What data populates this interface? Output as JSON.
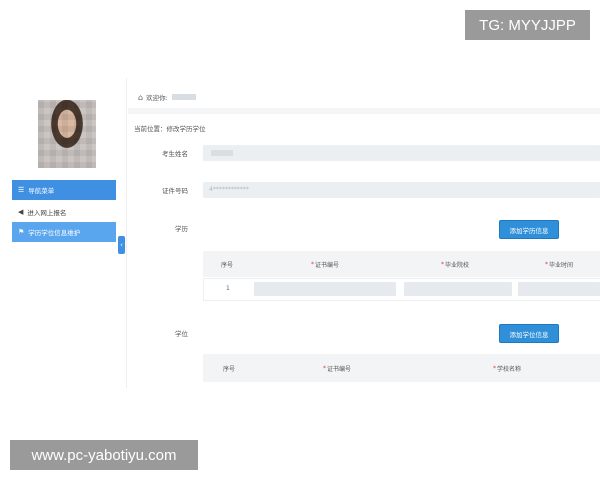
{
  "watermarks": {
    "top": "TG: MYYJJPP",
    "bottom": "www.pc-yabotiyu.com"
  },
  "header": {
    "welcome_label": "欢迎你:"
  },
  "breadcrumb": "当前位置：修改学历学位",
  "sidebar": {
    "items": [
      {
        "label": "导航菜单",
        "icon": "list-icon"
      },
      {
        "label": "进入网上报名",
        "icon": "speaker-icon"
      },
      {
        "label": "学历学位信息维护",
        "icon": "flag-icon"
      }
    ]
  },
  "form": {
    "name_label": "考生姓名",
    "id_label": "证件号码",
    "id_value": "4************",
    "education_label": "学历",
    "add_education_button": "添加学历信息",
    "degree_label": "学位",
    "add_degree_button": "添加学位信息"
  },
  "education_table": {
    "columns": [
      "序号",
      "证书编号",
      "毕业院校",
      "毕业时间"
    ],
    "rows": [
      {
        "index": "1"
      }
    ]
  },
  "degree_table": {
    "columns": [
      "序号",
      "证书编号",
      "学校名称"
    ]
  },
  "colors": {
    "primary": "#3f8fe3",
    "button": "#2f8fd8",
    "field_bg": "#eceff2",
    "required": "#e0413d"
  }
}
